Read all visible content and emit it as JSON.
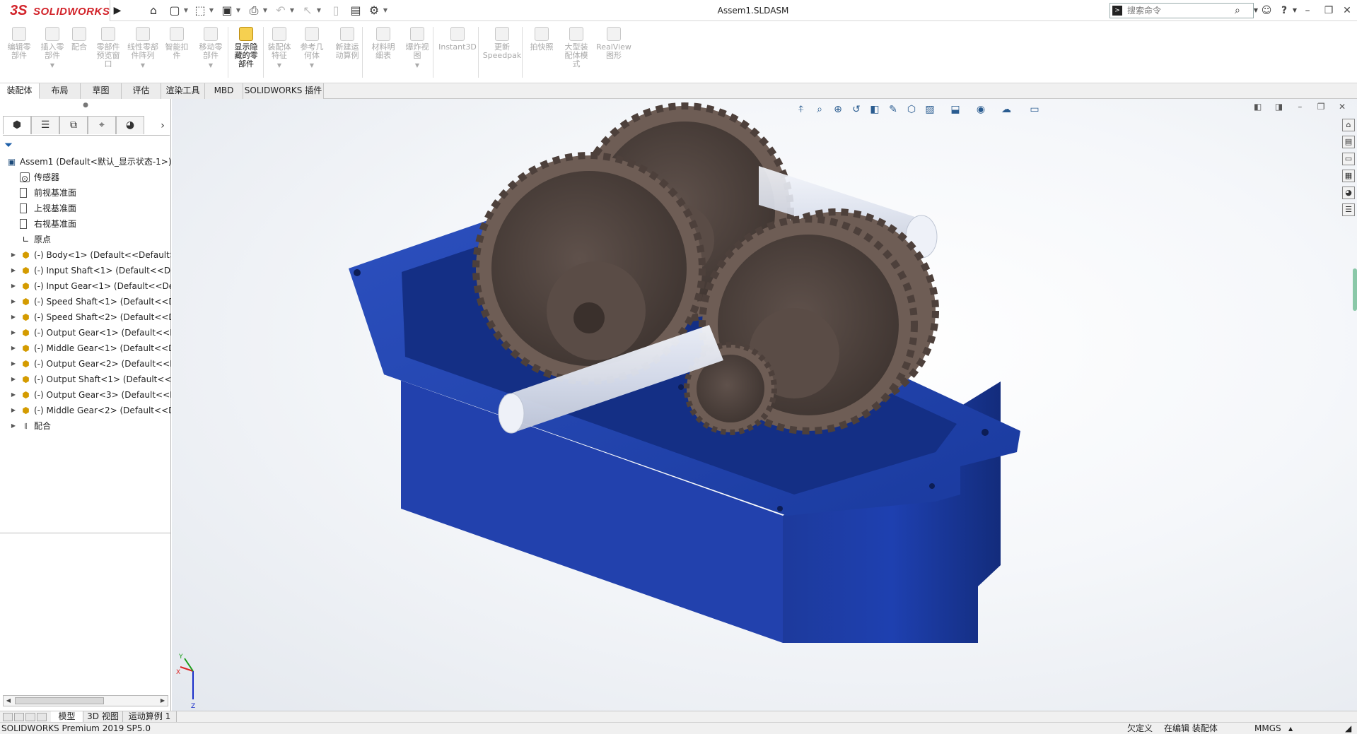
{
  "app": {
    "logo_ds": "3S",
    "logo_text": "SOLIDWORKS",
    "document_title": "Assem1.SLDASM"
  },
  "search": {
    "placeholder": "搜索命令"
  },
  "command_manager": [
    {
      "label": "编辑零\n部件",
      "enabled": false,
      "dropdown": false
    },
    {
      "label": "插入零\n部件",
      "enabled": false,
      "dropdown": true
    },
    {
      "label": "配合",
      "enabled": false,
      "dropdown": false
    },
    {
      "label": "零部件\n预览窗\n口",
      "enabled": false,
      "dropdown": false
    },
    {
      "label": "线性零部\n件阵列",
      "enabled": false,
      "dropdown": true
    },
    {
      "label": "智能扣\n件",
      "enabled": false,
      "dropdown": false
    },
    {
      "label": "移动零\n部件",
      "enabled": false,
      "dropdown": true
    },
    {
      "label": "显示隐\n藏的零\n部件",
      "enabled": true,
      "dropdown": false
    },
    {
      "label": "装配体\n特征",
      "enabled": false,
      "dropdown": true
    },
    {
      "label": "参考几\n何体",
      "enabled": false,
      "dropdown": true
    },
    {
      "label": "新建运\n动算例",
      "enabled": false,
      "dropdown": false
    },
    {
      "label": "材料明\n细表",
      "enabled": false,
      "dropdown": false
    },
    {
      "label": "爆炸视\n图",
      "enabled": false,
      "dropdown": true
    },
    {
      "label": "Instant3D",
      "enabled": false,
      "dropdown": false
    },
    {
      "label": "更新\nSpeedpak",
      "enabled": false,
      "dropdown": false
    },
    {
      "label": "拍快照",
      "enabled": false,
      "dropdown": false
    },
    {
      "label": "大型装\n配体模\n式",
      "enabled": false,
      "dropdown": false
    },
    {
      "label": "RealView\n图形",
      "enabled": false,
      "dropdown": false
    }
  ],
  "tabs": [
    "装配体",
    "布局",
    "草图",
    "评估",
    "渲染工具",
    "MBD",
    "SOLIDWORKS 插件"
  ],
  "active_tab": 0,
  "tree": {
    "root": "Assem1  (Default<默认_显示状态-1>)",
    "items": [
      {
        "label": "传感器",
        "icon": "sensor-icon",
        "expandable": false
      },
      {
        "label": "前视基准面",
        "icon": "plane-icon",
        "expandable": false
      },
      {
        "label": "上视基准面",
        "icon": "plane-icon",
        "expandable": false
      },
      {
        "label": "右视基准面",
        "icon": "plane-icon",
        "expandable": false
      },
      {
        "label": "原点",
        "icon": "origin-icon",
        "expandable": false
      },
      {
        "label": "(-) Body<1> (Default<<Default>_",
        "icon": "part-icon",
        "expandable": true
      },
      {
        "label": "(-) Input Shaft<1> (Default<<Def",
        "icon": "part-icon",
        "expandable": true
      },
      {
        "label": "(-) Input Gear<1> (Default<<Def",
        "icon": "part-icon",
        "expandable": true
      },
      {
        "label": "(-) Speed Shaft<1> (Default<<De",
        "icon": "part-icon",
        "expandable": true
      },
      {
        "label": "(-) Speed Shaft<2> (Default<<De",
        "icon": "part-icon",
        "expandable": true
      },
      {
        "label": "(-) Output Gear<1> (Default<<D",
        "icon": "part-icon",
        "expandable": true
      },
      {
        "label": "(-) Middle Gear<1> (Default<<D",
        "icon": "part-icon",
        "expandable": true
      },
      {
        "label": "(-) Output Gear<2> (Default<<D",
        "icon": "part-icon",
        "expandable": true
      },
      {
        "label": "(-) Output Shaft<1> (Default<<D",
        "icon": "part-icon",
        "expandable": true
      },
      {
        "label": "(-) Output Gear<3> (Default<<D",
        "icon": "part-icon",
        "expandable": true
      },
      {
        "label": "(-) Middle Gear<2> (Default<<D",
        "icon": "part-icon",
        "expandable": true
      },
      {
        "label": "配合",
        "icon": "mates-icon",
        "expandable": true
      }
    ]
  },
  "bottom_tabs": [
    "模型",
    "3D 视图",
    "运动算例 1"
  ],
  "status": {
    "product": "SOLIDWORKS Premium 2019 SP5.0",
    "define_state": "欠定义",
    "edit_state": "在编辑 装配体",
    "units": "MMGS"
  },
  "colors": {
    "body_blue": "#1d3fa3",
    "gear_brown": "#6b5a52",
    "shaft_clear": "#e6e9f2",
    "logo_red": "#d2232a"
  }
}
